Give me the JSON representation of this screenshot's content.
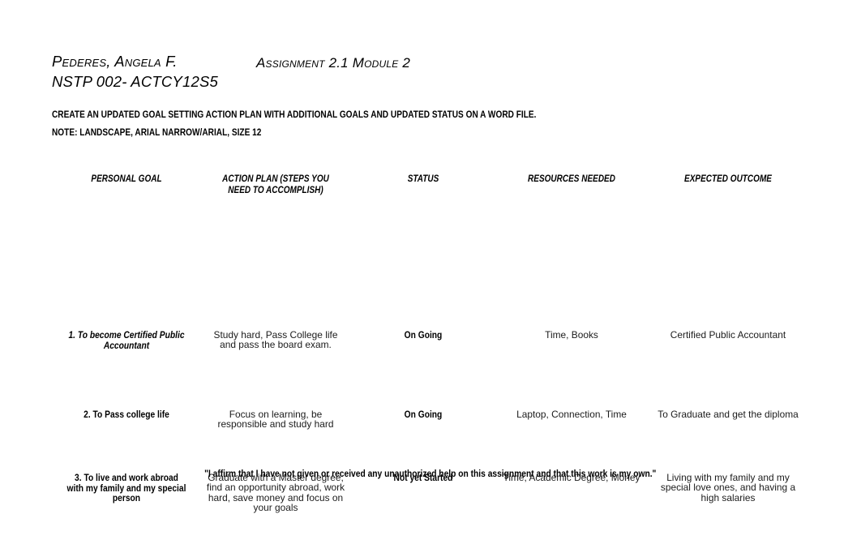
{
  "document": {
    "background_color": "#ffffff",
    "text_color": "#000000"
  },
  "header": {
    "student_name": "Pederes, Angela F.",
    "course_code": "NSTP 002- ACTCY12S5",
    "assignment_title": "Assignment 2.1 Module 2"
  },
  "instructions": {
    "line1": "CREATE AN UPDATED GOAL SETTING ACTION PLAN WITH ADDITIONAL GOALS AND UPDATED STATUS ON A WORD FILE.",
    "line2": "NOTE: LANDSCAPE, ARIAL NARROW/ARIAL, SIZE 12"
  },
  "table": {
    "columns": [
      "PERSONAL GOAL",
      "ACTION PLAN (STEPS YOU NEED TO ACCOMPLISH)",
      "STATUS",
      "RESOURCES NEEDED",
      "EXPECTED OUTCOME"
    ],
    "rows": [
      {
        "personal_goal": "1. To become Certified Public Accountant",
        "action_plan": "Study hard, Pass College life and pass the board exam.",
        "status": "On Going",
        "resources_needed": "Time, Books",
        "expected_outcome": "Certified Public Accountant"
      },
      {
        "personal_goal": "2. To Pass college life",
        "action_plan": "Focus on learning, be responsible and study hard",
        "status": "On Going",
        "resources_needed": "Laptop, Connection, Time",
        "expected_outcome": "To Graduate and get the diploma"
      },
      {
        "personal_goal": "3. To live and work abroad with my family and my special person",
        "action_plan": "Graduate with a Master degree, find an opportunity abroad, work hard, save money and focus on your goals",
        "status": "Not yet Started",
        "resources_needed": "Time, Academic Degree, Money",
        "expected_outcome": "Living with my family and my special love ones, and having a high salaries"
      }
    ]
  },
  "footer": {
    "affirmation": "\"I affirm that I have not given or received any unauthorized help on this assignment and that this work is my own.\""
  }
}
